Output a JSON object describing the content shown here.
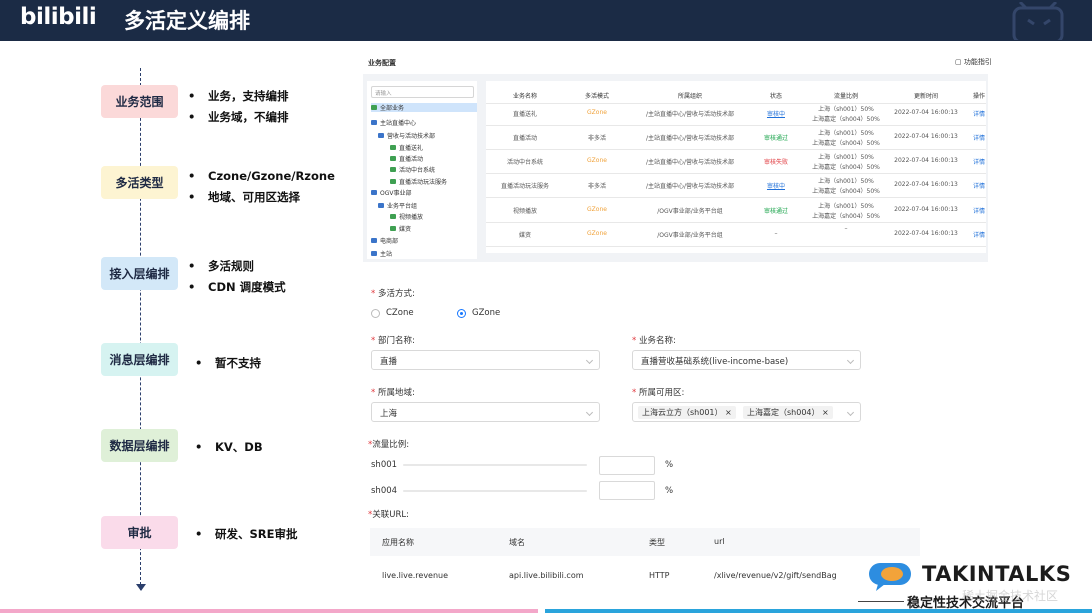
{
  "header": {
    "logo": "bilibili",
    "title": "多活定义编排"
  },
  "sections": [
    {
      "label": "业务范围",
      "color": "#fbd9d9",
      "bullets": [
        "业务，支持编排",
        "业务域，不编排"
      ]
    },
    {
      "label": "多活类型",
      "color": "#fdf4d2",
      "bullets": [
        "Czone/Gzone/Rzone",
        "地域、可用区选择"
      ]
    },
    {
      "label": "接入层编排",
      "color": "#d3e8f8",
      "bullets": [
        "多活规则",
        "CDN 调度模式"
      ]
    },
    {
      "label": "消息层编排",
      "color": "#d6f3f1",
      "bullets": [
        "暂不支持"
      ]
    },
    {
      "label": "数据层编排",
      "color": "#dff0d8",
      "bullets": [
        "KV、DB"
      ]
    },
    {
      "label": "审批",
      "color": "#fadbea",
      "bullets": [
        "研发、SRE审批"
      ]
    }
  ],
  "panel": {
    "title": "业务配置",
    "help": "功能指引",
    "search_placeholder": "请输入",
    "tree": [
      "全部业务",
      "主站直播中心",
      "营收与活动技术部",
      "直播送礼",
      "直播活动",
      "活动中台系统",
      "直播活动玩法服务",
      "OGV事业部",
      "业务平台组",
      "视频播放",
      "媒资",
      "电商部",
      "主站"
    ],
    "columns": [
      "业务名称",
      "多活模式",
      "所属组织",
      "状态",
      "流量比例",
      "更新时间",
      "操作"
    ],
    "rows": [
      {
        "name": "直播送礼",
        "mode": "GZone",
        "org": "/主站直播中心/营收与活动技术部",
        "status": "审核中",
        "ratio": [
          "上海（sh001）50%",
          "上海嘉定（sh004）50%"
        ],
        "time": "2022-07-04 16:00:13",
        "op": "详情"
      },
      {
        "name": "直播活动",
        "mode": "非多活",
        "org": "/主站直播中心/营收与活动技术部",
        "status": "审核通过",
        "ratio": [
          "上海（sh001）50%",
          "上海嘉定（sh004）50%"
        ],
        "time": "2022-07-04 16:00:13",
        "op": "详情"
      },
      {
        "name": "活动中台系统",
        "mode": "GZone",
        "org": "/主站直播中心/营收与活动技术部",
        "status": "审核失败",
        "ratio": [
          "上海（sh001）50%",
          "上海嘉定（sh004）50%"
        ],
        "time": "2022-07-04 16:00:13",
        "op": "详情"
      },
      {
        "name": "直播活动玩法服务",
        "mode": "非多活",
        "org": "/主站直播中心/营收与活动技术部",
        "status": "审核中",
        "ratio": [
          "上海（sh001）50%",
          "上海嘉定（sh004）50%"
        ],
        "time": "2022-07-04 16:00:13",
        "op": "详情"
      },
      {
        "name": "视频播放",
        "mode": "GZone",
        "org": "/OGV事业部/业务平台组",
        "status": "审核通过",
        "ratio": [
          "上海（sh001）50%",
          "上海嘉定（sh004）50%"
        ],
        "time": "2022-07-04 16:00:13",
        "op": "详情"
      },
      {
        "name": "媒资",
        "mode": "GZone",
        "org": "/OGV事业部/业务平台组",
        "status": "–",
        "ratio": [
          "–",
          ""
        ],
        "time": "2022-07-04 16:00:13",
        "op": "详情"
      }
    ]
  },
  "form": {
    "mode_label": "多活方式:",
    "czone": "CZone",
    "gzone": "GZone",
    "dept_label": "部门名称:",
    "dept_value": "直播",
    "biz_label": "业务名称:",
    "biz_value": "直播营收基础系统(live-income-base)",
    "region_label": "所属地域:",
    "region_value": "上海",
    "zone_label": "所属可用区:",
    "zone_tags": [
      "上海云立方（sh001）",
      "上海嘉定（sh004）"
    ],
    "traffic_label": "流量比例:",
    "traffic": [
      {
        "name": "sh001",
        "unit": "%"
      },
      {
        "name": "sh004",
        "unit": "%"
      }
    ],
    "url_label": "关联URL:",
    "url_columns": [
      "应用名称",
      "域名",
      "类型",
      "url"
    ],
    "url_row": [
      "live.live.revenue",
      "api.live.bilibili.com",
      "HTTP",
      "/xlive/revenue/v2/gift/sendBag"
    ]
  },
  "brand": {
    "name": "TAKINTALKS",
    "subtitle": "稳定性技术交流平台",
    "watermark": "稀土掘金技术社区"
  }
}
